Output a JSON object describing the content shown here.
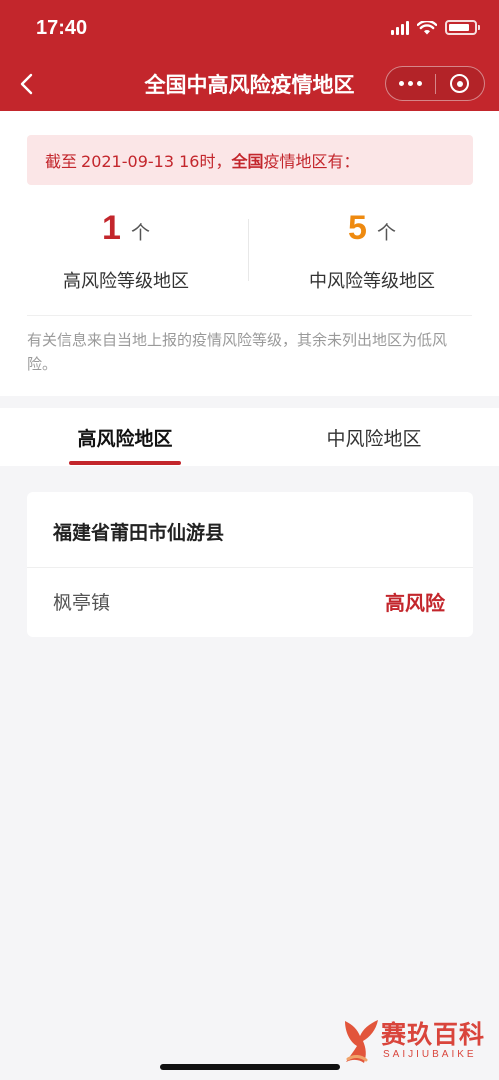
{
  "status_bar": {
    "time": "17:40",
    "battery_level_percent": 85
  },
  "nav": {
    "title": "全国中高风险疫情地区"
  },
  "summary": {
    "notice": {
      "prefix": "截至",
      "date_time": "2021-09-13 16时，",
      "scope": "全国",
      "suffix": "疫情地区有："
    },
    "high": {
      "count": "1",
      "unit": "个",
      "label": "高风险等级地区"
    },
    "medium": {
      "count": "5",
      "unit": "个",
      "label": "中风险等级地区"
    },
    "disclaimer": "有关信息来自当地上报的疫情风险等级，其余未列出地区为低风险。"
  },
  "tabs": [
    {
      "label": "高风险地区",
      "active": true
    },
    {
      "label": "中风险地区",
      "active": false
    }
  ],
  "regions": [
    {
      "name": "福建省莆田市仙游县",
      "areas": [
        {
          "name": "枫亭镇",
          "risk": "高风险"
        }
      ]
    }
  ],
  "watermark": {
    "text": "赛玖百科",
    "sub": "SAIJIUBAIKE"
  },
  "colors": {
    "brand_red": "#c3262c",
    "medium_orange": "#ee8a10",
    "notice_bg": "#fbe6e7"
  }
}
